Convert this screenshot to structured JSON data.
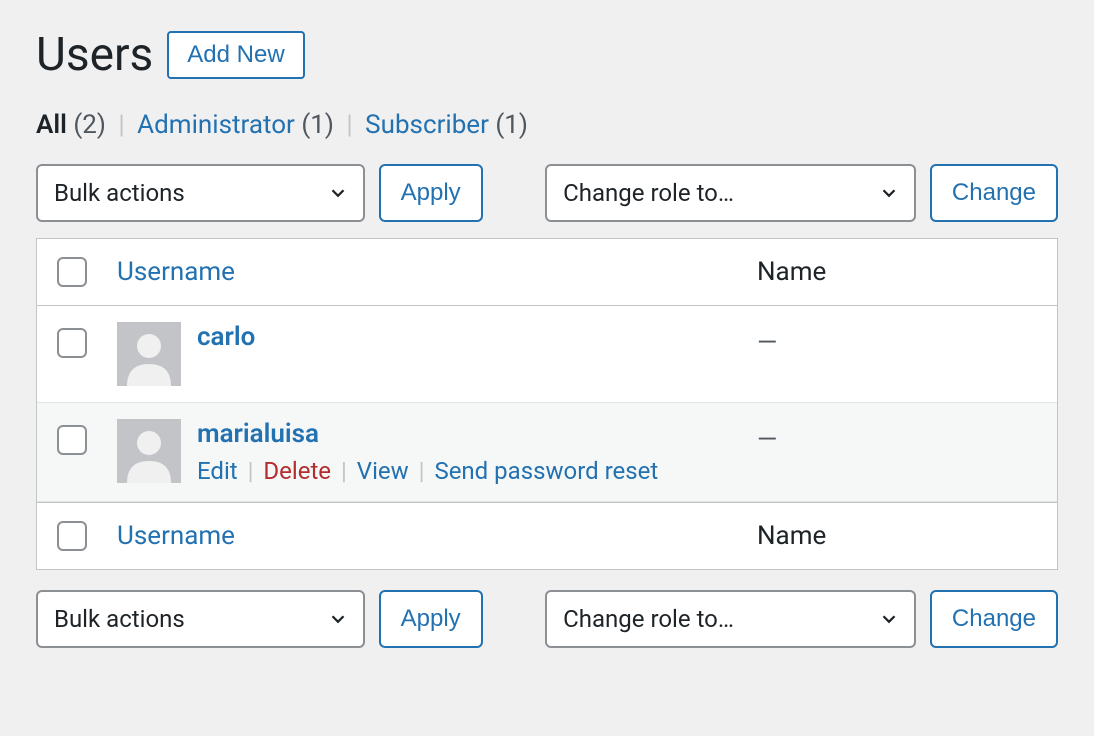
{
  "header": {
    "title": "Users",
    "add_new": "Add New"
  },
  "filters": {
    "items": [
      {
        "label": "All",
        "count": "(2)",
        "active": true
      },
      {
        "label": "Administrator",
        "count": "(1)",
        "active": false
      },
      {
        "label": "Subscriber",
        "count": "(1)",
        "active": false
      }
    ],
    "separator": "|"
  },
  "actions": {
    "bulk_label": "Bulk actions",
    "apply": "Apply",
    "role_label": "Change role to…",
    "change": "Change"
  },
  "table": {
    "columns": {
      "username": "Username",
      "name": "Name"
    },
    "rows": [
      {
        "username": "carlo",
        "name": "—",
        "show_actions": false
      },
      {
        "username": "marialuisa",
        "name": "—",
        "show_actions": true
      }
    ],
    "row_actions": {
      "edit": "Edit",
      "delete": "Delete",
      "view": "View",
      "send_reset": "Send password reset"
    }
  }
}
